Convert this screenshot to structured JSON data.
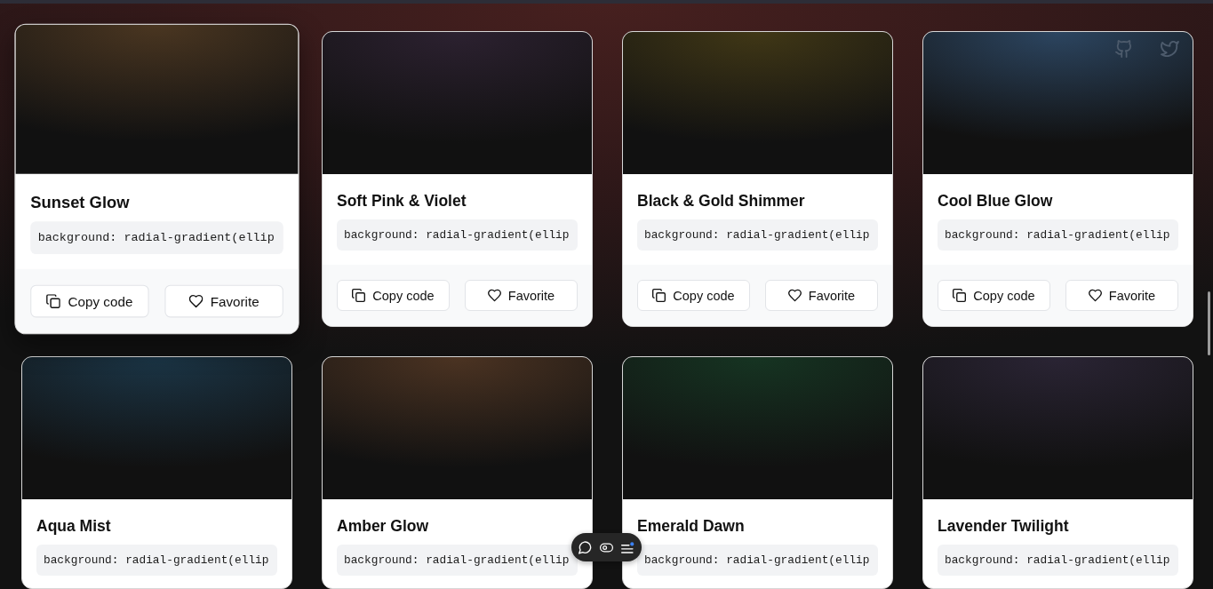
{
  "cards": [
    {
      "title": "Sunset Glow",
      "code": "background: radial-gradient(ellip",
      "color": "#4a3621",
      "hovered": true,
      "buttons": [
        {
          "kind": "copy",
          "label": "Copy code"
        },
        {
          "kind": "favorite",
          "label": "Favorite"
        }
      ]
    },
    {
      "title": "Soft Pink & Violet",
      "code": "background: radial-gradient(ellip",
      "color": "#2c2130",
      "hovered": false,
      "buttons": [
        {
          "kind": "copy",
          "label": "Copy code"
        },
        {
          "kind": "favorite",
          "label": "Favorite"
        }
      ]
    },
    {
      "title": "Black & Gold Shimmer",
      "code": "background: radial-gradient(ellip",
      "color": "#403716",
      "hovered": false,
      "buttons": [
        {
          "kind": "copy",
          "label": "Copy code"
        },
        {
          "kind": "favorite",
          "label": "Favorite"
        }
      ]
    },
    {
      "title": "Cool Blue Glow",
      "code": "background: radial-gradient(ellip",
      "color": "#2c4560",
      "hovered": false,
      "buttons": [
        {
          "kind": "copy",
          "label": "Copy code"
        },
        {
          "kind": "favorite",
          "label": "Favorite"
        }
      ]
    },
    {
      "title": "Aqua Mist",
      "code": "background: radial-gradient(ellip",
      "color": "#1b3546",
      "hovered": false
    },
    {
      "title": "Amber Glow",
      "code": "background: radial-gradient(ellip",
      "color": "#4b3322",
      "hovered": false
    },
    {
      "title": "Emerald Dawn",
      "code": "background: radial-gradient(ellip",
      "color": "#163422",
      "hovered": false
    },
    {
      "title": "Lavender Twilight",
      "code": "background: radial-gradient(ellip",
      "color": "#2a2434",
      "hovered": false
    }
  ]
}
